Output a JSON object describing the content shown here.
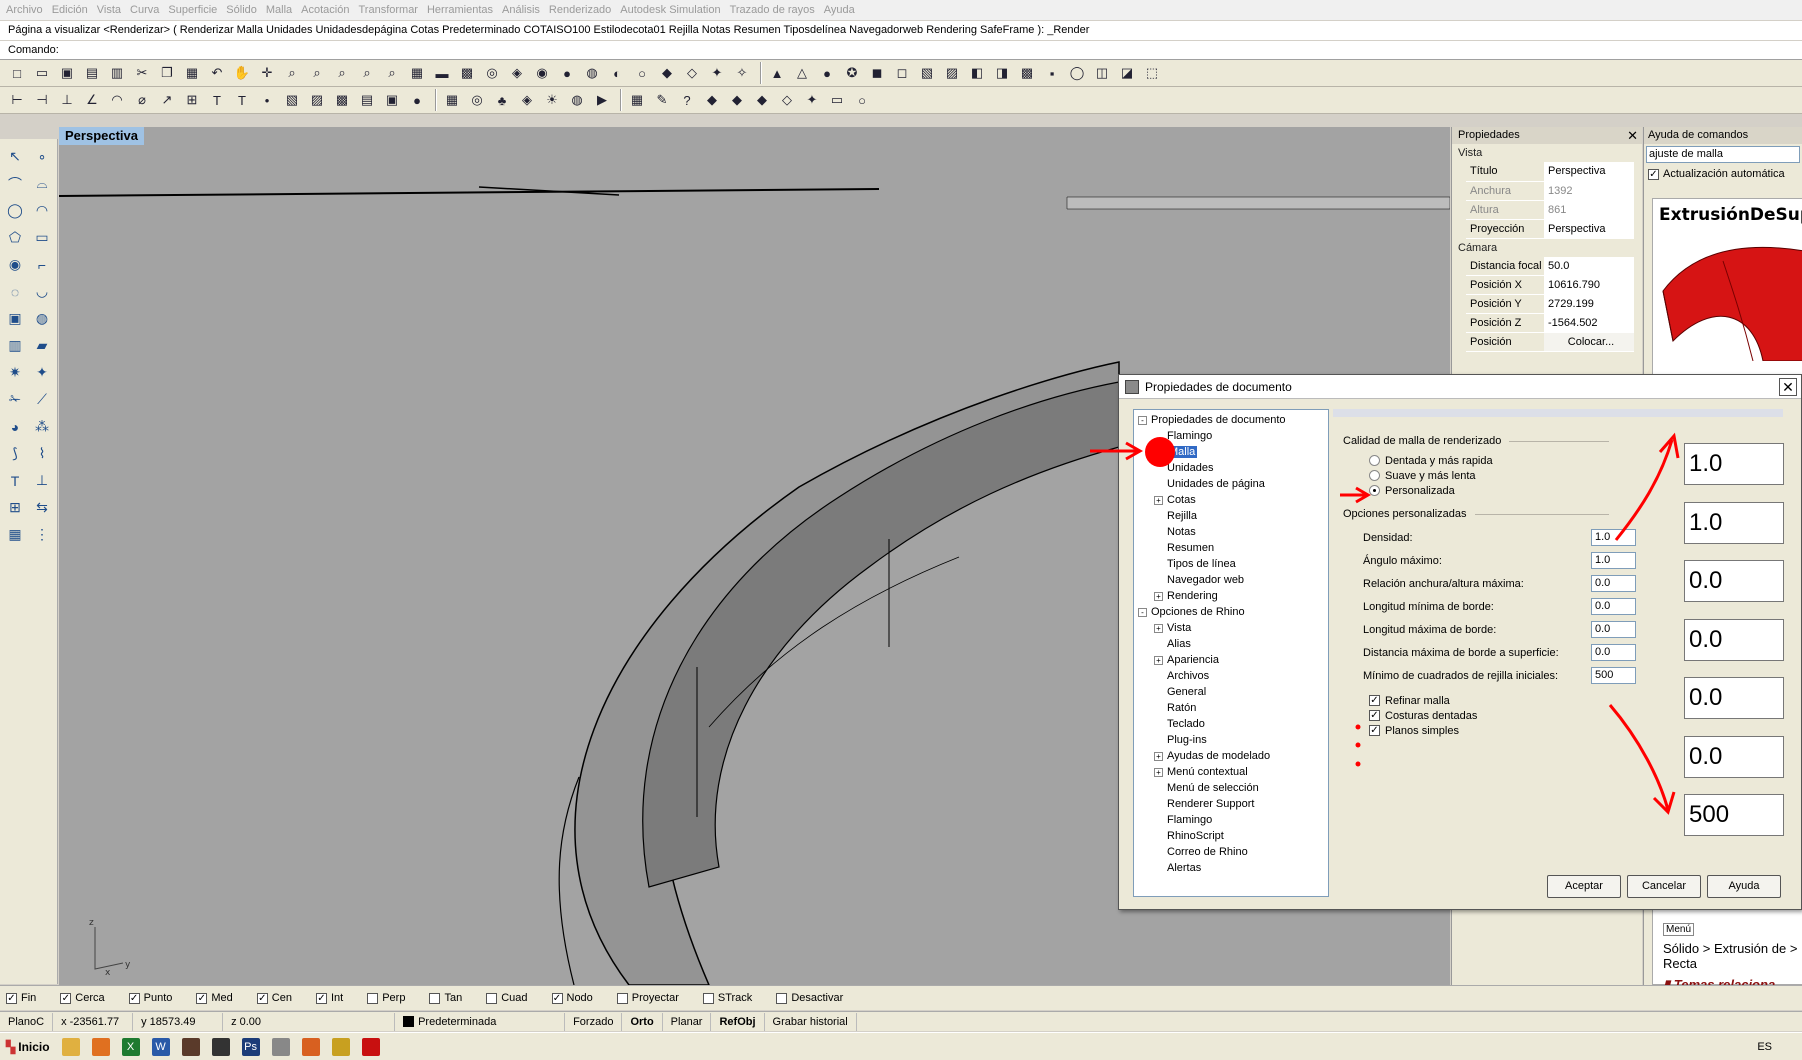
{
  "menu": [
    "Archivo",
    "Edición",
    "Vista",
    "Curva",
    "Superficie",
    "Sólido",
    "Malla",
    "Acotación",
    "Transformar",
    "Herramientas",
    "Análisis",
    "Renderizado",
    "Autodesk Simulation",
    "Trazado de rayos",
    "Ayuda"
  ],
  "command_history": "Página a visualizar <Renderizar> ( Renderizar  Malla  Unidades  Unidadesdepágina  Cotas  Predeterminado  COTAISO100  Estilodecota01  Rejilla  Notas  Resumen  Tiposdelínea  Navegadorweb  Rendering  SafeFrame ): _Render",
  "command_prompt": "Comando:",
  "viewport_label": "Perspectiva",
  "properties": {
    "title": "Propiedades",
    "section_view": "Vista",
    "rows_view": [
      {
        "k": "Título",
        "v": "Perspectiva",
        "disabled": false
      },
      {
        "k": "Anchura",
        "v": "1392",
        "disabled": true
      },
      {
        "k": "Altura",
        "v": "861",
        "disabled": true
      },
      {
        "k": "Proyección",
        "v": "Perspectiva",
        "disabled": false
      }
    ],
    "section_camera": "Cámara",
    "rows_camera": [
      {
        "k": "Distancia focal",
        "v": "50.0"
      },
      {
        "k": "Posición X",
        "v": "10616.790"
      },
      {
        "k": "Posición Y",
        "v": "2729.199"
      },
      {
        "k": "Posición Z",
        "v": "-1564.502"
      },
      {
        "k": "Posición",
        "v": "Colocar..."
      }
    ]
  },
  "help": {
    "title": "Ayuda de comandos",
    "search": "ajuste de malla",
    "auto_update": "Actualización automática",
    "heading": "ExtrusiónDeSup",
    "menu_tag": "Menú",
    "crumbs": "Sólido > Extrusión de > Recta",
    "related": "Temas relaciona"
  },
  "dialog": {
    "title": "Propiedades de documento",
    "tree": [
      {
        "label": "Propiedades de documento",
        "level": 0,
        "exp": "-",
        "sel": false
      },
      {
        "label": "Flamingo",
        "level": 1,
        "exp": "",
        "sel": false
      },
      {
        "label": "Malla",
        "level": 1,
        "exp": "",
        "sel": true
      },
      {
        "label": "Unidades",
        "level": 1,
        "exp": "",
        "sel": false
      },
      {
        "label": "Unidades de página",
        "level": 1,
        "exp": "",
        "sel": false
      },
      {
        "label": "Cotas",
        "level": 1,
        "exp": "+",
        "sel": false
      },
      {
        "label": "Rejilla",
        "level": 1,
        "exp": "",
        "sel": false
      },
      {
        "label": "Notas",
        "level": 1,
        "exp": "",
        "sel": false
      },
      {
        "label": "Resumen",
        "level": 1,
        "exp": "",
        "sel": false
      },
      {
        "label": "Tipos de línea",
        "level": 1,
        "exp": "",
        "sel": false
      },
      {
        "label": "Navegador web",
        "level": 1,
        "exp": "",
        "sel": false
      },
      {
        "label": "Rendering",
        "level": 1,
        "exp": "+",
        "sel": false
      },
      {
        "label": "Opciones de Rhino",
        "level": 0,
        "exp": "-",
        "sel": false
      },
      {
        "label": "Vista",
        "level": 1,
        "exp": "+",
        "sel": false
      },
      {
        "label": "Alias",
        "level": 1,
        "exp": "",
        "sel": false
      },
      {
        "label": "Apariencia",
        "level": 1,
        "exp": "+",
        "sel": false
      },
      {
        "label": "Archivos",
        "level": 1,
        "exp": "",
        "sel": false
      },
      {
        "label": "General",
        "level": 1,
        "exp": "",
        "sel": false
      },
      {
        "label": "Ratón",
        "level": 1,
        "exp": "",
        "sel": false
      },
      {
        "label": "Teclado",
        "level": 1,
        "exp": "",
        "sel": false
      },
      {
        "label": "Plug-ins",
        "level": 1,
        "exp": "",
        "sel": false
      },
      {
        "label": "Ayudas de modelado",
        "level": 1,
        "exp": "+",
        "sel": false
      },
      {
        "label": "Menú contextual",
        "level": 1,
        "exp": "+",
        "sel": false
      },
      {
        "label": "Menú de selección",
        "level": 1,
        "exp": "",
        "sel": false
      },
      {
        "label": "Renderer Support",
        "level": 1,
        "exp": "",
        "sel": false
      },
      {
        "label": "Flamingo",
        "level": 1,
        "exp": "",
        "sel": false
      },
      {
        "label": "RhinoScript",
        "level": 1,
        "exp": "",
        "sel": false
      },
      {
        "label": "Correo de Rhino",
        "level": 1,
        "exp": "",
        "sel": false
      },
      {
        "label": "Alertas",
        "level": 1,
        "exp": "",
        "sel": false
      }
    ],
    "quality_group": "Calidad de malla de renderizado",
    "radios": [
      {
        "label": "Dentada y más rapida",
        "on": false
      },
      {
        "label": "Suave y más lenta",
        "on": false
      },
      {
        "label": "Personalizada",
        "on": true
      }
    ],
    "custom_group": "Opciones personalizadas",
    "fields": [
      {
        "label": "Densidad:",
        "value": "1.0"
      },
      {
        "label": "Ángulo máximo:",
        "value": "1.0"
      },
      {
        "label": "Relación anchura/altura máxima:",
        "value": "0.0"
      },
      {
        "label": "Longitud mínima de borde:",
        "value": "0.0"
      },
      {
        "label": "Longitud máxima de borde:",
        "value": "0.0"
      },
      {
        "label": "Distancia máxima de borde a superficie:",
        "value": "0.0"
      },
      {
        "label": "Mínimo de cuadrados de rejilla iniciales:",
        "value": "500"
      }
    ],
    "checks": [
      {
        "label": "Refinar malla",
        "on": true
      },
      {
        "label": "Costuras dentadas",
        "on": true
      },
      {
        "label": "Planos simples",
        "on": true
      }
    ],
    "ok": "Aceptar",
    "cancel": "Cancelar",
    "help": "Ayuda"
  },
  "zoomed_values": [
    "1.0",
    "1.0",
    "0.0",
    "0.0",
    "0.0",
    "0.0",
    "500"
  ],
  "osnaps": [
    {
      "label": "Fin",
      "on": true
    },
    {
      "label": "Cerca",
      "on": true
    },
    {
      "label": "Punto",
      "on": true
    },
    {
      "label": "Med",
      "on": true
    },
    {
      "label": "Cen",
      "on": true
    },
    {
      "label": "Int",
      "on": true
    },
    {
      "label": "Perp",
      "on": false
    },
    {
      "label": "Tan",
      "on": false
    },
    {
      "label": "Cuad",
      "on": false
    },
    {
      "label": "Nodo",
      "on": true
    },
    {
      "label": "Proyectar",
      "on": false
    },
    {
      "label": "STrack",
      "on": false
    },
    {
      "label": "Desactivar",
      "on": false
    }
  ],
  "status": {
    "plane": "PlanoC",
    "x": "x -23561.77",
    "y": "y 18573.49",
    "z": "z 0.00",
    "layer": "Predeterminada",
    "toggles": [
      "Forzado",
      "Orto",
      "Planar",
      "RefObj",
      "Grabar historial"
    ]
  },
  "taskbar": {
    "start": "Inicio",
    "lang": "ES"
  },
  "colors": {
    "annotation": "#ff0000",
    "selection": "#316ac5",
    "viewport": "#a3a3a3"
  }
}
